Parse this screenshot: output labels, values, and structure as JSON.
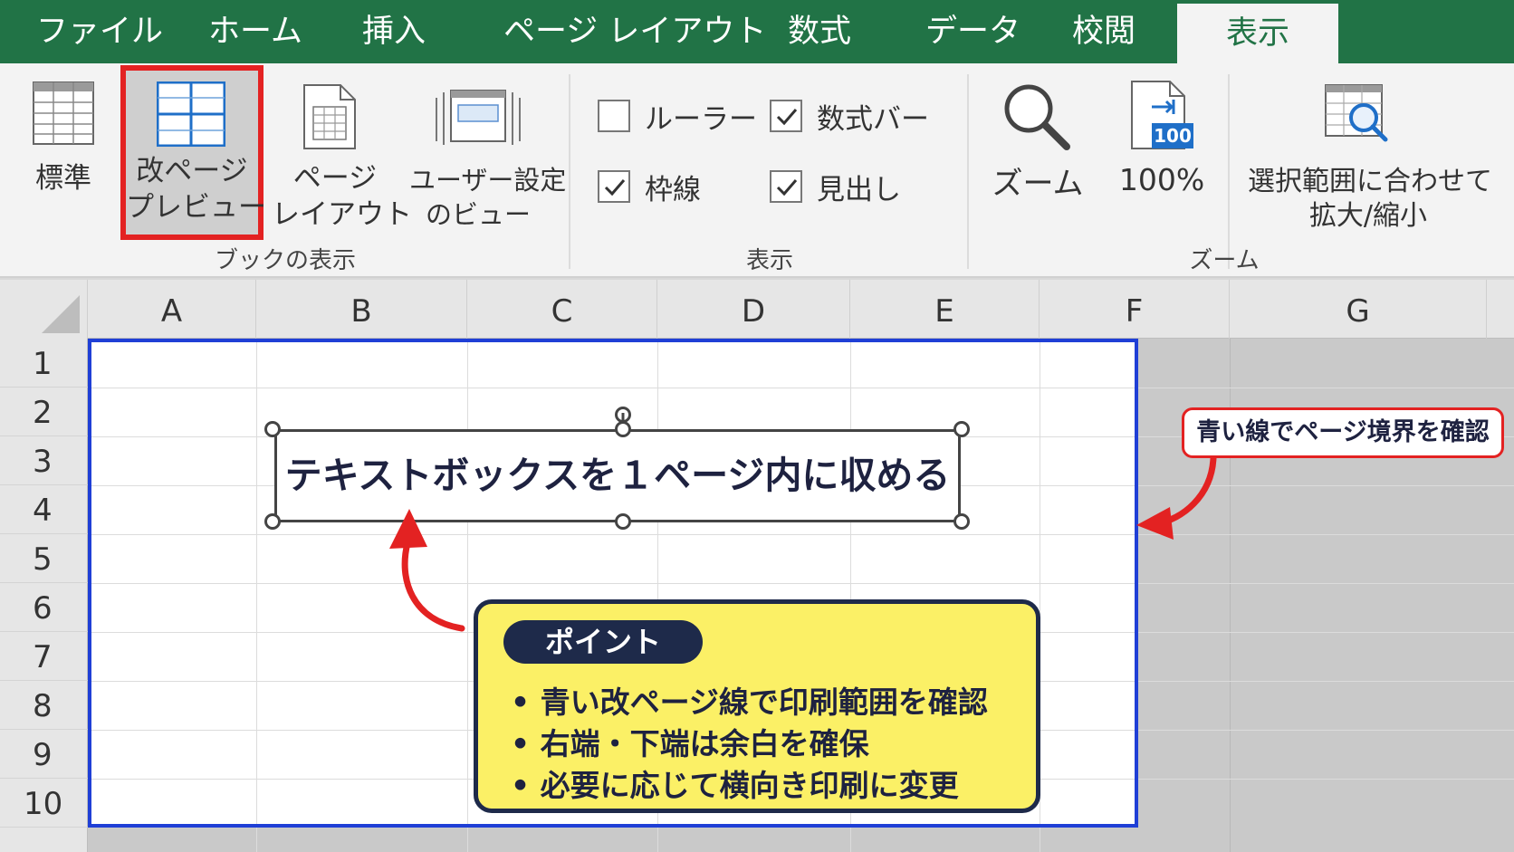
{
  "tabs": [
    {
      "label": "ファイル"
    },
    {
      "label": "ホーム"
    },
    {
      "label": "挿入"
    },
    {
      "label": "ページ レイアウト"
    },
    {
      "label": "数式"
    },
    {
      "label": "データ"
    },
    {
      "label": "校閲"
    },
    {
      "label": "表示"
    }
  ],
  "active_tab": "表示",
  "ribbon": {
    "workbook_views": {
      "group_label": "ブックの表示",
      "normal": "標準",
      "page_break_preview": {
        "line1": "改ページ",
        "line2": "プレビュー"
      },
      "page_layout": {
        "line1": "ページ",
        "line2": "レイアウト"
      },
      "custom_views": {
        "line1": "ユーザー設定",
        "line2": "のビュー"
      }
    },
    "show": {
      "group_label": "表示",
      "ruler": {
        "label": "ルーラー",
        "checked": false
      },
      "formula_bar": {
        "label": "数式バー",
        "checked": true
      },
      "gridlines": {
        "label": "枠線",
        "checked": true
      },
      "headings": {
        "label": "見出し",
        "checked": true
      }
    },
    "zoom": {
      "group_label": "ズーム",
      "zoom": "ズーム",
      "zoom_100": "100%",
      "zoom_100_badge": "100",
      "zoom_to_selection": {
        "line1": "選択範囲に合わせて",
        "line2": "拡大/縮小"
      }
    }
  },
  "columns": [
    "A",
    "B",
    "C",
    "D",
    "E",
    "F",
    "G"
  ],
  "rows": [
    "1",
    "2",
    "3",
    "4",
    "5",
    "6",
    "7",
    "8",
    "9",
    "10"
  ],
  "textbox": {
    "text": "テキストボックスを１ページ内に収める"
  },
  "annotations": {
    "border_note": "青い線でページ境界を確認",
    "point": {
      "title": "ポイント",
      "items": [
        "• 青い改ページ線で印刷範囲を確認",
        "• 右端・下端は余白を確保",
        "• 必要に応じて横向き印刷に変更"
      ]
    }
  },
  "colors": {
    "tab_bar": "#217346",
    "page_border": "#1f3fd6",
    "highlight": "#e32222",
    "point_bg": "#fbf066",
    "point_border": "#1e2a4a"
  }
}
